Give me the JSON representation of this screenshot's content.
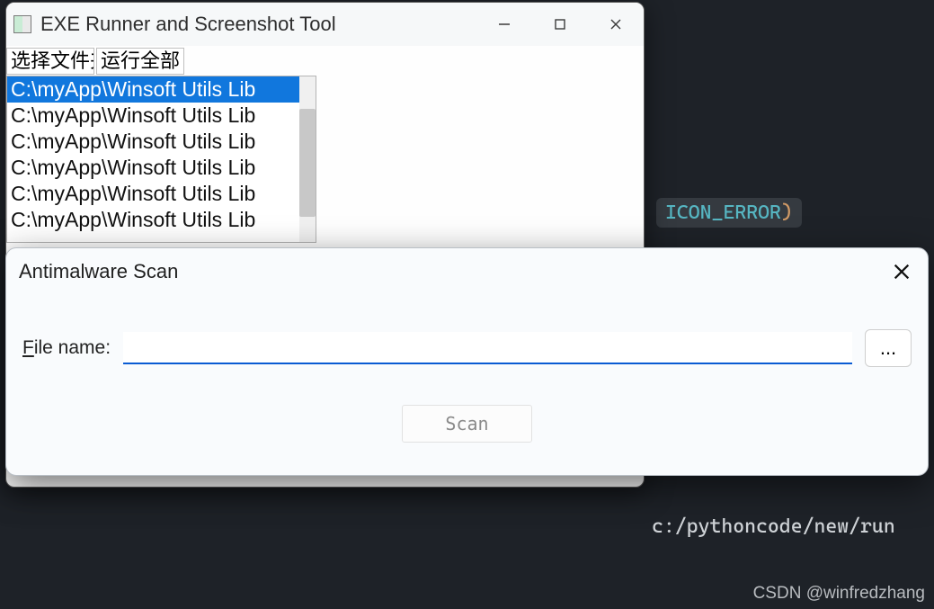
{
  "editor": {
    "token_id": "ICON_ERROR",
    "token_paren": ")",
    "path_line": "c:/pythoncode/new/run",
    "watermark": "CSDN @winfredzhang"
  },
  "runner_window": {
    "title": "EXE Runner and Screenshot Tool",
    "toolbar": {
      "choose_files": "选择文件夹",
      "run_all": "运行全部"
    },
    "list_items": [
      "C:\\myApp\\Winsoft Utils Lib",
      "C:\\myApp\\Winsoft Utils Lib",
      "C:\\myApp\\Winsoft Utils Lib",
      "C:\\myApp\\Winsoft Utils Lib",
      "C:\\myApp\\Winsoft Utils Lib",
      "C:\\myApp\\Winsoft Utils Lib"
    ],
    "selected_index": 0
  },
  "scan_dialog": {
    "title": "Antimalware Scan",
    "file_label_underlined": "F",
    "file_label_rest": "ile name:",
    "file_value": "",
    "browse_label": "...",
    "scan_label": "Scan"
  }
}
